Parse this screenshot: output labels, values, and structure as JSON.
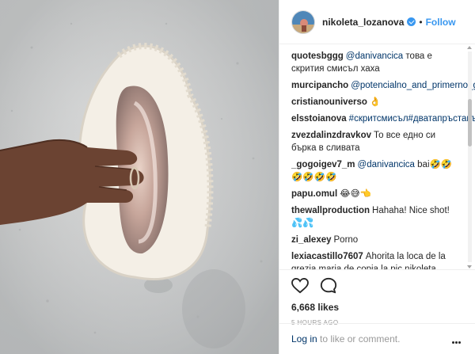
{
  "post": {
    "username": "nikoleta_lozanova",
    "dot": "•",
    "follow_label": "Follow",
    "likes": "6,668 likes",
    "time": "5 HOURS AGO",
    "login_link": "Log in",
    "login_rest": " to like or comment."
  },
  "comments": [
    {
      "user": "quotesbggg",
      "mention": "@danivancica",
      "text": " това е скрития смисъл хаха"
    },
    {
      "user": "murcipancho",
      "mention": "@potencialno_and_primerno_guze",
      "text": ""
    },
    {
      "user": "cristianouniverso",
      "mention": "",
      "text": "👌"
    },
    {
      "user": "elsstoianova",
      "mention": "#скритсмисъл#дватапръставътре",
      "text": ""
    },
    {
      "user": "zvezdalinzdravkov",
      "mention": "",
      "text": "То все едно си бърка в сливата"
    },
    {
      "user": "_gogoigev7_m",
      "mention": "@danivancica",
      "text": " bai🤣🤣🤣🤣🤣🤣"
    },
    {
      "user": "papu.omul",
      "mention": "",
      "text": "😂😅👈"
    },
    {
      "user": "thewallproduction",
      "mention": "",
      "text": "Hahaha! Nice shot! 💦💦"
    },
    {
      "user": "zi_alexey",
      "mention": "",
      "text": "Porno"
    },
    {
      "user": "lexiacastillo7607",
      "mention": "",
      "text": "Ahorita la loca de la grezia maria de copia la pic nikoleta aquas!!!!!"
    }
  ],
  "icons": [
    "heart-icon",
    "comment-icon",
    "more-options-icon",
    "verified-badge-icon"
  ],
  "colors": {
    "accent": "#3897f0",
    "mention": "#003569",
    "muted": "#999999"
  }
}
